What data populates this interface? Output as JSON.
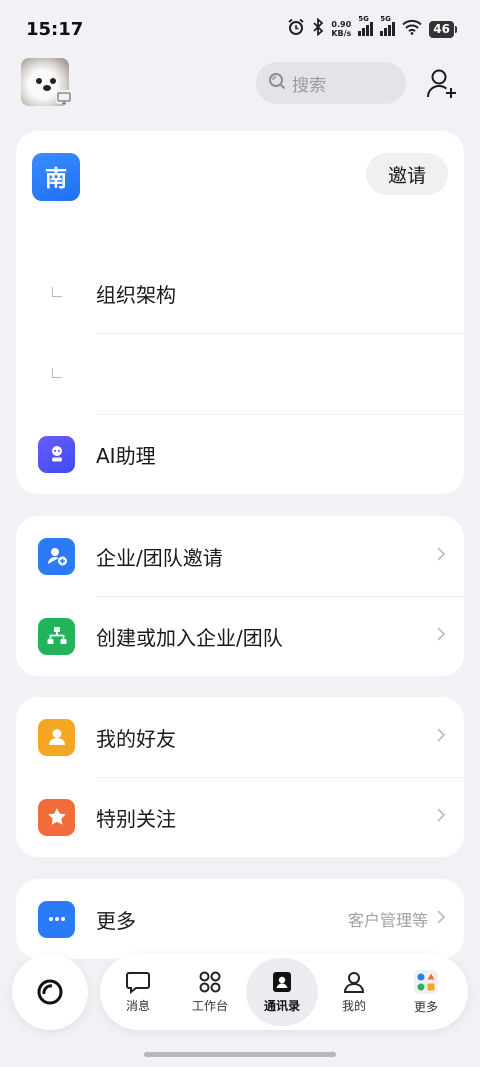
{
  "status_bar": {
    "time": "15:17",
    "net_speed_value": "0.90",
    "net_speed_unit": "KB/s",
    "signal1_label": "5G",
    "signal2_label": "5G",
    "battery": "46",
    "icons": [
      "alarm-icon",
      "bluetooth-icon",
      "signal-icon",
      "signal-icon",
      "wifi-icon",
      "battery-icon"
    ]
  },
  "header": {
    "search_placeholder": "搜索",
    "add_friend_icon": "add-person-icon"
  },
  "org_card": {
    "org_initial": "南",
    "invite_label": "邀请",
    "items": [
      {
        "label": "组织架构"
      },
      {
        "label": ""
      },
      {
        "label": "AI助理",
        "icon": "ai-assistant-icon"
      }
    ]
  },
  "team_card": {
    "items": [
      {
        "label": "企业/团队邀请",
        "icon": "team-invite-icon"
      },
      {
        "label": "创建或加入企业/团队",
        "icon": "org-structure-icon"
      }
    ]
  },
  "friends_card": {
    "items": [
      {
        "label": "我的好友",
        "icon": "friend-icon"
      },
      {
        "label": "特别关注",
        "icon": "star-icon"
      }
    ]
  },
  "more_card": {
    "label": "更多",
    "sub": "客户管理等",
    "icon": "more-dots-icon"
  },
  "bottom_nav": {
    "tabs": [
      {
        "label": "消息",
        "icon": "message-icon"
      },
      {
        "label": "工作台",
        "icon": "workbench-icon"
      },
      {
        "label": "通讯录",
        "icon": "contacts-icon",
        "active": true
      },
      {
        "label": "我的",
        "icon": "profile-icon"
      },
      {
        "label": "更多",
        "icon": "more-apps-icon"
      }
    ]
  },
  "colors": {
    "accent_blue": "#1f6ff5",
    "green": "#22b45a",
    "orange": "#f5a623",
    "red_orange": "#f26b3a",
    "purple": "#5b5bf0",
    "background": "#f2f2f6"
  }
}
